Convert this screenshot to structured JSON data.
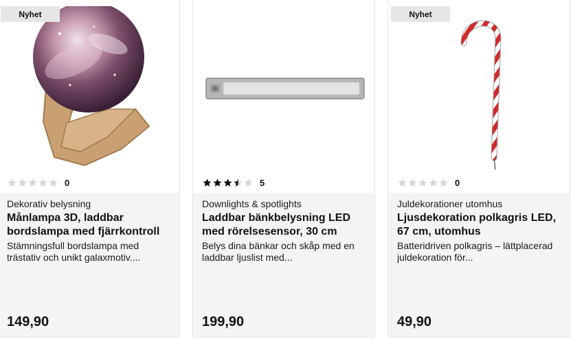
{
  "products": [
    {
      "badge": "Nyhet",
      "image_icon": "moon-lamp-image",
      "rating": 0,
      "review_count": "0",
      "category": "Dekorativ belysning",
      "title": "Månlampa 3D, laddbar bordslampa med fjärrkontroll",
      "description": "Stämningsfull bordslampa med trästativ och unikt galaxmotiv....",
      "price": "149,90"
    },
    {
      "badge": "",
      "image_icon": "led-light-bar-image",
      "rating": 3.5,
      "review_count": "5",
      "category": "Downlights & spotlights",
      "title": "Laddbar bänkbelysning LED med rörelsesensor, 30 cm",
      "description": "Belys dina bänkar och skåp med en laddbar ljuslist med...",
      "price": "199,90"
    },
    {
      "badge": "Nyhet",
      "image_icon": "candy-cane-image",
      "rating": 0,
      "review_count": "0",
      "category": "Juldekorationer utomhus",
      "title": "Ljusdekoration polkagris LED, 67 cm, utomhus",
      "description": "Batteridriven polkagris – lättplacerad juldekoration för...",
      "price": "49,90"
    }
  ],
  "colors": {
    "star_filled": "#111111",
    "star_empty": "#d6d6d6",
    "card_bg": "#f4f4f4",
    "badge_bg": "#e6e6e6"
  }
}
